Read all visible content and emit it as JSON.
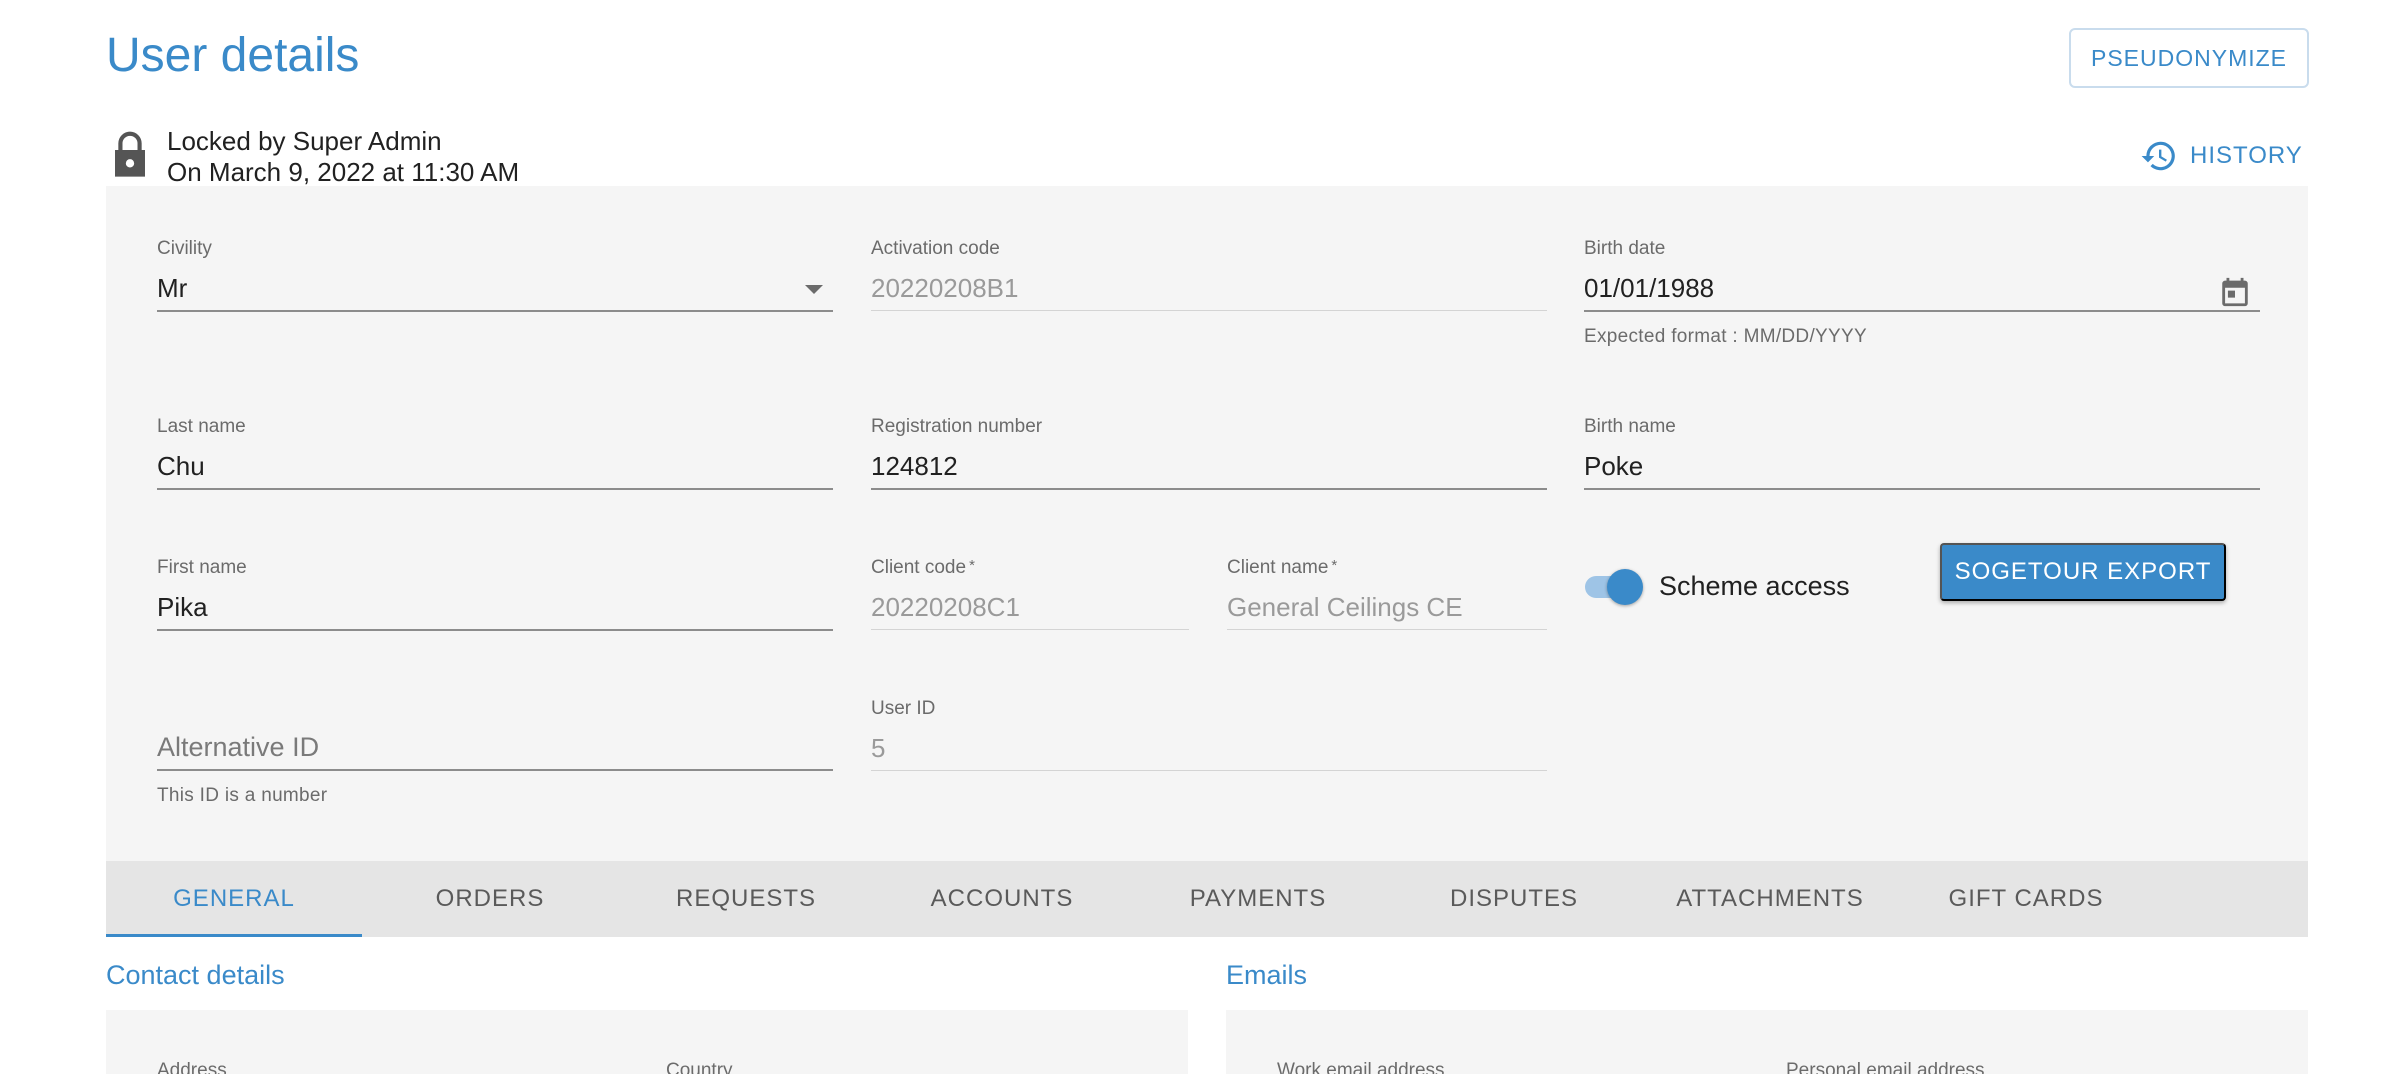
{
  "header": {
    "title": "User details",
    "pseudonymize_label": "PSEUDONYMIZE",
    "history_label": "HISTORY"
  },
  "lock": {
    "icon": "lock-icon",
    "locked_by": "Locked by Super Admin",
    "locked_on": "On March 9, 2022 at 11:30 AM"
  },
  "form": {
    "civility": {
      "label": "Civility",
      "value": "Mr"
    },
    "activation_code": {
      "label": "Activation code",
      "value": "20220208B1"
    },
    "birth_date": {
      "label": "Birth date",
      "value": "01/01/1988",
      "hint": "Expected format : MM/DD/YYYY"
    },
    "last_name": {
      "label": "Last name",
      "value": "Chu"
    },
    "registration_number": {
      "label": "Registration number",
      "value": "124812"
    },
    "birth_name": {
      "label": "Birth name",
      "value": "Poke"
    },
    "first_name": {
      "label": "First name",
      "value": "Pika"
    },
    "client_code": {
      "label": "Client code",
      "required_mark": "*",
      "value": "20220208C1"
    },
    "client_name": {
      "label": "Client name",
      "required_mark": "*",
      "value": "General Ceilings CE"
    },
    "scheme_access": {
      "label": "Scheme access",
      "enabled": true
    },
    "sogetour_export_label": "SOGETOUR EXPORT",
    "alternative_id": {
      "placeholder": "Alternative ID",
      "hint": "This ID is a number"
    },
    "user_id": {
      "label": "User ID",
      "value": "5"
    }
  },
  "tabs": [
    {
      "label": "GENERAL",
      "active": true
    },
    {
      "label": "ORDERS",
      "active": false
    },
    {
      "label": "REQUESTS",
      "active": false
    },
    {
      "label": "ACCOUNTS",
      "active": false
    },
    {
      "label": "PAYMENTS",
      "active": false
    },
    {
      "label": "DISPUTES",
      "active": false
    },
    {
      "label": "ATTACHMENTS",
      "active": false
    },
    {
      "label": "GIFT CARDS",
      "active": false
    }
  ],
  "sections": {
    "contact_details": {
      "title": "Contact details",
      "address_label": "Address",
      "country_label": "Country"
    },
    "emails": {
      "title": "Emails",
      "work_label": "Work email address",
      "personal_label": "Personal email address"
    }
  },
  "colors": {
    "accent": "#3a8ac9",
    "panel": "#f5f5f5",
    "tabs_bg": "#e5e5e5"
  }
}
